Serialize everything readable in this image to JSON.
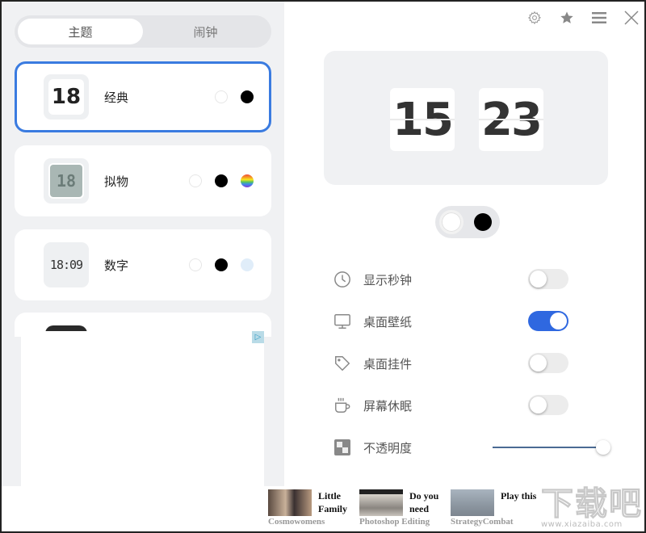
{
  "sidebar": {
    "tabs": [
      {
        "label": "主题",
        "active": true
      },
      {
        "label": "闹钟",
        "active": false
      }
    ],
    "themes": [
      {
        "name": "经典",
        "thumb_text": "18",
        "style": "classic",
        "selected": true,
        "swatches": [
          "white",
          "black"
        ]
      },
      {
        "name": "拟物",
        "thumb_text": "18",
        "style": "lcd",
        "selected": false,
        "swatches": [
          "white",
          "black",
          "rainbow"
        ]
      },
      {
        "name": "数字",
        "thumb_text": "18:09",
        "style": "digital",
        "selected": false,
        "swatches": [
          "white",
          "black",
          "lightblue"
        ]
      }
    ],
    "ad_badge": "▷"
  },
  "toolbar": {
    "icons": [
      "gear-icon",
      "star-icon",
      "menu-icon",
      "close-icon"
    ]
  },
  "preview": {
    "hours": "15",
    "minutes": "23"
  },
  "color_toggle": {
    "options": [
      "white",
      "black"
    ],
    "selected": "white"
  },
  "settings": [
    {
      "label": "显示秒钟",
      "icon": "clock-icon",
      "type": "switch",
      "on": false
    },
    {
      "label": "桌面壁纸",
      "icon": "monitor-icon",
      "type": "switch",
      "on": true
    },
    {
      "label": "桌面挂件",
      "icon": "tag-icon",
      "type": "switch",
      "on": false
    },
    {
      "label": "屏幕休眠",
      "icon": "coffee-cup-icon",
      "type": "switch",
      "on": false
    },
    {
      "label": "不透明度",
      "icon": "checkerboard-icon",
      "type": "slider",
      "value_percent": 100
    }
  ],
  "ads": [
    {
      "title": "Little Family",
      "source": "Cosmowomens"
    },
    {
      "title": "Do you need",
      "source": "Photoshop Editing"
    },
    {
      "title": "Play this",
      "source": "StrategyCombat"
    }
  ],
  "watermark": {
    "big": "下载吧",
    "small": "www.xiazaiba.com"
  },
  "colors": {
    "accent": "#2f68e0",
    "selected_border": "#3a7be0",
    "sidebar_bg": "#f0f1f3"
  }
}
